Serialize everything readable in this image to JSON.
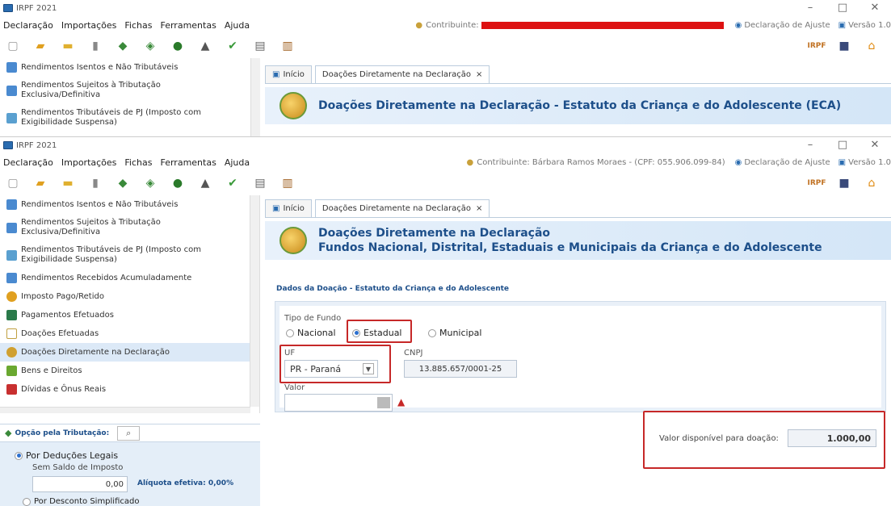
{
  "window": {
    "title": "IRPF 2021",
    "minimize": "–",
    "maximize": "□",
    "close": "✕"
  },
  "menu": [
    "Declaração",
    "Importações",
    "Fichas",
    "Ferramentas",
    "Ajuda"
  ],
  "top_window": {
    "contribuinte_label": "Contribuinte:",
    "declaracao_tipo": "Declaração de Ajuste",
    "versao": "Versão 1.0"
  },
  "contribuinte": "Contribuinte: Bárbara Ramos Moraes - (CPF: 055.906.099-84)",
  "declaracao_tipo": "Declaração de Ajuste",
  "versao": "Versão 1.0",
  "sidebar_items_top": [
    "Rendimentos Isentos e Não Tributáveis",
    "Rendimentos Sujeitos à Tributação Exclusiva/Definitiva",
    "Rendimentos Tributáveis de PJ (Imposto com Exigibilidade Suspensa)"
  ],
  "sidebar_items": [
    "Rendimentos Isentos e Não Tributáveis",
    "Rendimentos Sujeitos à Tributação Exclusiva/Definitiva",
    "Rendimentos Tributáveis de PJ (Imposto com Exigibilidade Suspensa)",
    "Rendimentos Recebidos Acumuladamente",
    "Imposto Pago/Retido",
    "Pagamentos Efetuados",
    "Doações Efetuadas",
    "Doações Diretamente na Declaração",
    "Bens e Direitos",
    "Dívidas e Ônus Reais"
  ],
  "tabs": {
    "home": "Início",
    "active": "Doações Diretamente na Declaração",
    "close": "×"
  },
  "top_header": "Doações Diretamente na Declaração - Estatuto da Criança e do Adolescente (ECA)",
  "header": {
    "line1": "Doações Diretamente na Declaração",
    "line2": "Fundos Nacional, Distrital, Estaduais e Municipais da Criança e do Adolescente"
  },
  "section_title": "Dados da Doação - Estatuto da Criança e do Adolescente",
  "form": {
    "tipo_fundo_label": "Tipo de Fundo",
    "options": [
      "Nacional",
      "Estadual",
      "Municipal"
    ],
    "selected": "Estadual",
    "uf_label": "UF",
    "uf_value": "PR - Paraná",
    "cnpj_label": "CNPJ",
    "cnpj_value": "13.885.657/0001-25",
    "valor_label": "Valor",
    "valor_value": ""
  },
  "disponivel": {
    "label": "Valor disponível para doação:",
    "value": "1.000,00"
  },
  "opcao": {
    "title": "Opção pela Tributação:",
    "option1": "Por Deduções Legais",
    "sub": "Sem Saldo de Imposto",
    "value": "0,00",
    "aliquota": "Alíquota efetiva: 0,00%",
    "option2": "Por Desconto Simplificado"
  },
  "colors": {
    "accent": "#1d4f8a",
    "highlight": "#c62828",
    "selection": "#dce9f7"
  }
}
